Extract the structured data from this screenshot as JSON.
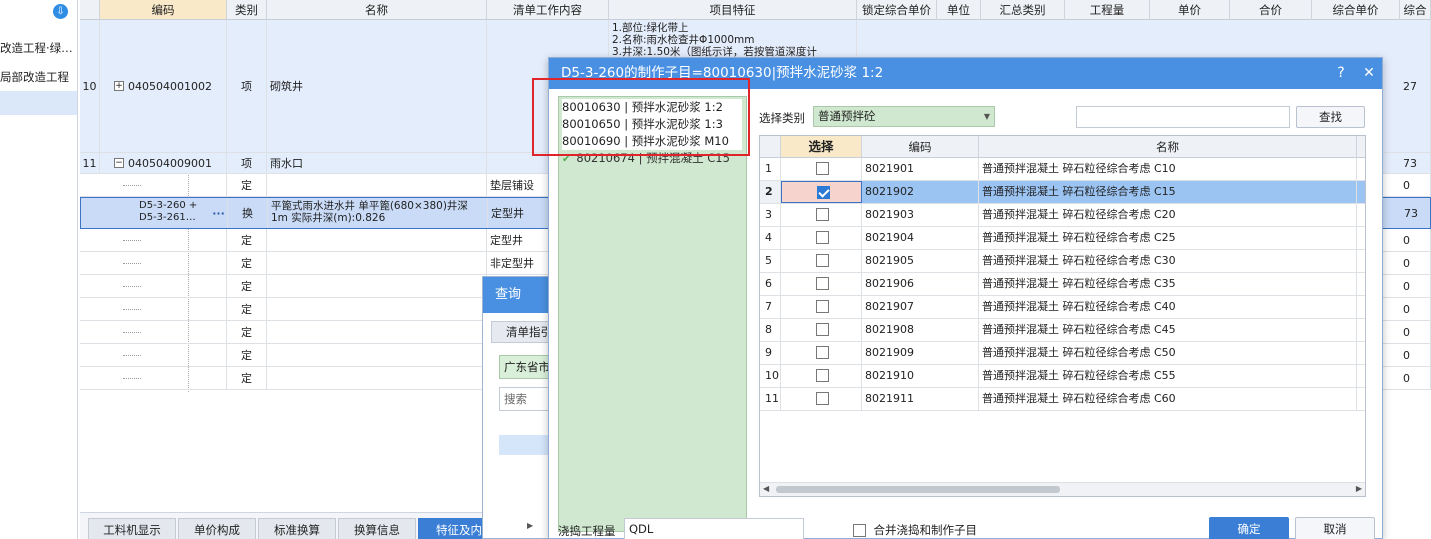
{
  "left_nav": {
    "items": [
      "改造工程·绿…",
      "局部改造工程",
      ""
    ]
  },
  "grid": {
    "headers": [
      "编码",
      "类别",
      "名称",
      "清单工作内容",
      "项目特征",
      "锁定综合单价",
      "单位",
      "汇总类别",
      "工程量",
      "单价",
      "合价",
      "综合单价",
      "综合"
    ],
    "rows": [
      {
        "no": "10",
        "tree": "+",
        "code": "040504001002",
        "type": "项",
        "name": "砌筑井",
        "content": "",
        "feature": "1.部位:绿化带上\n2.名称:雨水检查井Φ1000mm\n3.井深:1.50米（图纸示详，若按管道深度计",
        "tail": "27"
      },
      {
        "no": "11",
        "tree": "−",
        "code": "040504009001",
        "type": "项",
        "name": "雨水口",
        "content": "",
        "feature": "",
        "tail": "73"
      },
      {
        "no": "",
        "tree": "",
        "code": "",
        "type": "定",
        "name": "",
        "content": "垫层铺设",
        "feature": "",
        "tail": "0"
      },
      {
        "no": "",
        "tree": "",
        "code": "D5-3-260 + D5-3-261…",
        "type": "换",
        "name": "平篦式雨水进水井 单平篦(680×380)井深 1m  实际井深(m):0.826",
        "content": "定型井",
        "feature": "",
        "tail": "73"
      },
      {
        "no": "",
        "tree": "",
        "code": "",
        "type": "定",
        "name": "",
        "content": "定型井",
        "feature": "",
        "tail": "0"
      },
      {
        "no": "",
        "tree": "",
        "code": "",
        "type": "定",
        "name": "",
        "content": "非定型井",
        "feature": "",
        "tail": "0"
      },
      {
        "no": "",
        "tree": "",
        "code": "",
        "type": "定",
        "name": "",
        "content": "",
        "feature": "",
        "tail": "0"
      },
      {
        "no": "",
        "tree": "",
        "code": "",
        "type": "定",
        "name": "",
        "content": "",
        "feature": "",
        "tail": "0"
      },
      {
        "no": "",
        "tree": "",
        "code": "",
        "type": "定",
        "name": "",
        "content": "",
        "feature": "",
        "tail": "0"
      },
      {
        "no": "",
        "tree": "",
        "code": "",
        "type": "定",
        "name": "",
        "content": "",
        "feature": "",
        "tail": "0"
      },
      {
        "no": "",
        "tree": "",
        "code": "",
        "type": "定",
        "name": "",
        "content": "",
        "feature": "",
        "tail": "0"
      }
    ],
    "more_icon": "···"
  },
  "bottom_tabs": [
    "工料机显示",
    "单价构成",
    "标准换算",
    "换算信息",
    "特征及内"
  ],
  "query_window": {
    "title": "查询",
    "tab": "清单指引",
    "combo": "广东省市",
    "search_placeholder": "搜索",
    "arrow": "▶"
  },
  "dialog": {
    "title": "D5-3-260的制作子目=80010630|预拌水泥砂浆 1:2",
    "help": "?",
    "close": "✕",
    "materials": [
      {
        "text": "80010630 | 预拌水泥砂浆 1:2",
        "checked": false
      },
      {
        "text": "80010650 | 预拌水泥砂浆 1:3",
        "checked": false
      },
      {
        "text": "80010690 | 预拌水泥砂浆 M10",
        "checked": false
      },
      {
        "text": "80210674 | 预拌混凝土 C15",
        "checked": true
      }
    ],
    "category_label": "选择类别",
    "category_value": "普通预拌砼",
    "find_button": "查找",
    "table_headers": [
      "",
      "选择",
      "编码",
      "名称"
    ],
    "table_rows": [
      {
        "no": "1",
        "checked": false,
        "code": "8021901",
        "name": "普通预拌混凝土 碎石粒径综合考虑 C10"
      },
      {
        "no": "2",
        "checked": true,
        "code": "8021902",
        "name": "普通预拌混凝土 碎石粒径综合考虑 C15"
      },
      {
        "no": "3",
        "checked": false,
        "code": "8021903",
        "name": "普通预拌混凝土 碎石粒径综合考虑 C20"
      },
      {
        "no": "4",
        "checked": false,
        "code": "8021904",
        "name": "普通预拌混凝土 碎石粒径综合考虑 C25"
      },
      {
        "no": "5",
        "checked": false,
        "code": "8021905",
        "name": "普通预拌混凝土 碎石粒径综合考虑 C30"
      },
      {
        "no": "6",
        "checked": false,
        "code": "8021906",
        "name": "普通预拌混凝土 碎石粒径综合考虑 C35"
      },
      {
        "no": "7",
        "checked": false,
        "code": "8021907",
        "name": "普通预拌混凝土 碎石粒径综合考虑 C40"
      },
      {
        "no": "8",
        "checked": false,
        "code": "8021908",
        "name": "普通预拌混凝土 碎石粒径综合考虑 C45"
      },
      {
        "no": "9",
        "checked": false,
        "code": "8021909",
        "name": "普通预拌混凝土 碎石粒径综合考虑 C50"
      },
      {
        "no": "10",
        "checked": false,
        "code": "8021910",
        "name": "普通预拌混凝土 碎石粒径综合考虑 C55"
      },
      {
        "no": "11",
        "checked": false,
        "code": "8021911",
        "name": "普通预拌混凝土 碎石粒径综合考虑 C60"
      }
    ],
    "qty_label": "浇捣工程量",
    "qty_value": "QDL",
    "merge_label": "合并浇捣和制作子目",
    "ok_button": "确定",
    "cancel_button": "取消"
  },
  "colors": {
    "accent": "#4a90e2",
    "highlight_box": "#e0242b",
    "green_panel": "#cfe8cf",
    "selected_row": "#9cc4f3"
  }
}
